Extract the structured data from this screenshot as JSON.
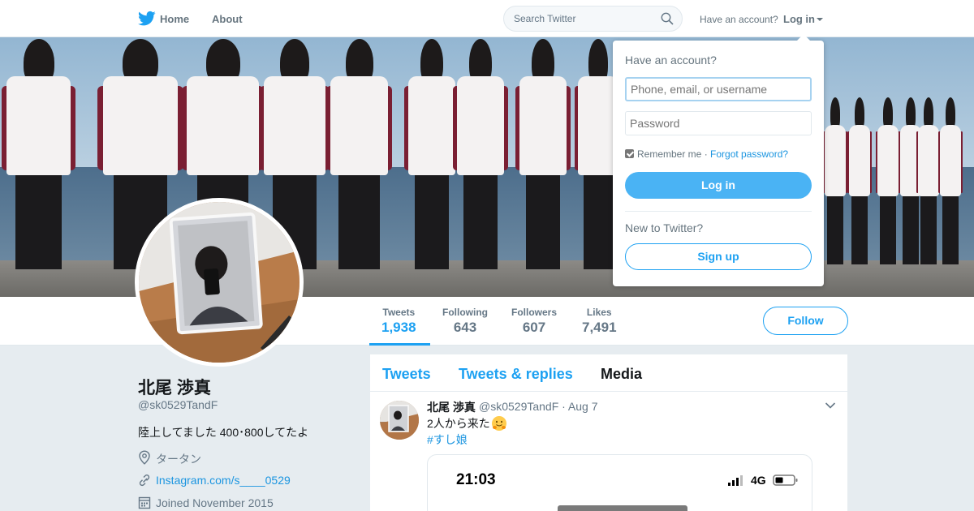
{
  "nav": {
    "home_label": "Home",
    "about_label": "About",
    "search_placeholder": "Search Twitter",
    "have_account": "Have an account?",
    "login_label": "Log in"
  },
  "stats": {
    "tweets_label": "Tweets",
    "tweets_value": "1,938",
    "following_label": "Following",
    "following_value": "643",
    "followers_label": "Followers",
    "followers_value": "607",
    "likes_label": "Likes",
    "likes_value": "7,491"
  },
  "follow_label": "Follow",
  "profile": {
    "name": "北尾 渉真",
    "handle": "@sk0529TandF",
    "bio": "陸上してました 400･800してたよ",
    "location": "タータン",
    "website": "Instagram.com/s____0529",
    "joined": "Joined November 2015"
  },
  "timeline": {
    "tabs": [
      "Tweets",
      "Tweets & replies",
      "Media"
    ]
  },
  "tweet": {
    "name": "北尾 渉真",
    "handle_date": "@sk0529TandF · Aug 7",
    "text": "2人から来た",
    "hashtag": "#すし娘",
    "media_time": "21:03",
    "media_network": "4G"
  },
  "login_dropdown": {
    "title": "Have an account?",
    "username_placeholder": "Phone, email, or username",
    "password_placeholder": "Password",
    "remember": "Remember me",
    "separator": " · ",
    "forgot": "Forgot password?",
    "login_button": "Log in",
    "new_prompt": "New to Twitter?",
    "signup_button": "Sign up"
  },
  "colors": {
    "accent": "#1da1f2",
    "link": "#1b95e0",
    "background": "#e6ecf0"
  }
}
